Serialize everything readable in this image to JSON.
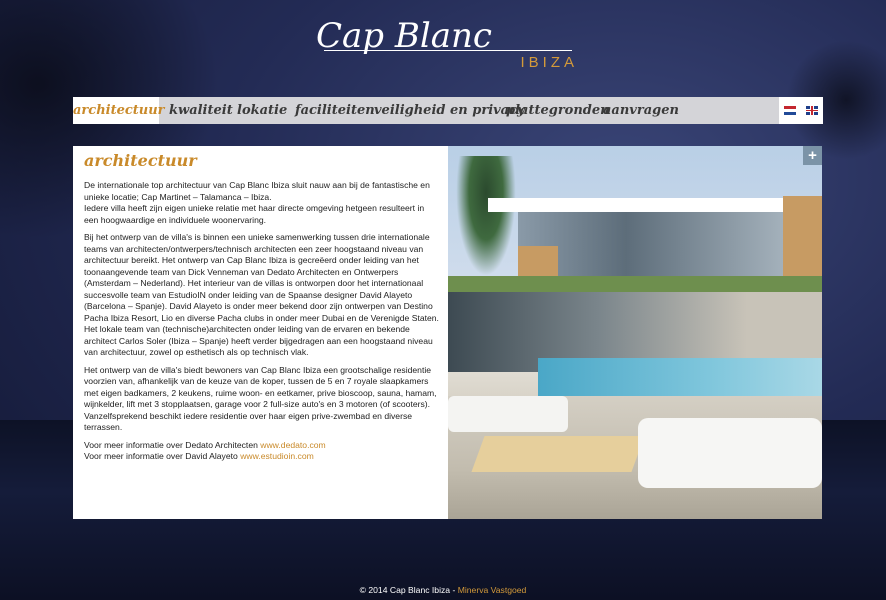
{
  "logo": {
    "main": "Cap Blanc",
    "sub": "IBIZA"
  },
  "nav": {
    "items": [
      {
        "label": "architectuur",
        "active": true
      },
      {
        "label": "kwaliteit"
      },
      {
        "label": "lokatie"
      },
      {
        "label": "faciliteiten"
      },
      {
        "label": "veiligheid en privacy"
      },
      {
        "label": "plattegronden"
      },
      {
        "label": "aanvragen"
      }
    ],
    "languages": [
      "nl",
      "en"
    ]
  },
  "content": {
    "title": "architectuur",
    "paragraphs": [
      "De internationale top architectuur van Cap Blanc Ibiza sluit nauw aan bij de fantastische en unieke locatie; Cap Martinet – Talamanca – Ibiza.",
      "Iedere villa heeft zijn eigen unieke relatie met haar directe omgeving hetgeen resulteert in een hoogwaardige en individuele woonervaring.",
      "Bij het ontwerp van de villa's is binnen een unieke samenwerking tussen drie internationale teams van architecten/ontwerpers/technisch architecten een zeer hoogstaand niveau van architectuur bereikt. Het ontwerp van Cap Blanc Ibiza is gecreëerd onder leiding van het toonaangevende team van Dick Venneman van Dedato Architecten en Ontwerpers (Amsterdam – Nederland). Het interieur van de villas is ontworpen door het internationaal succesvolle team van EstudioIN onder leiding van de Spaanse designer David Alayeto (Barcelona – Spanje). David Alayeto is onder meer bekend door zijn ontwerpen van Destino Pacha Ibiza Resort, Lio en diverse Pacha clubs in onder meer Dubai en de Verenigde Staten. Het lokale team van (technische)architecten onder leiding van de ervaren en bekende architect Carlos Soler (Ibiza – Spanje) heeft verder bijgedragen aan een hoogstaand niveau van architectuur, zowel op esthetisch als op technisch vlak.",
      "Het ontwerp van de villa's biedt bewoners van Cap Blanc Ibiza een grootschalige residentie voorzien van, afhankelijk van de keuze van de koper, tussen de 5 en 7 royale slaapkamers met eigen badkamers, 2 keukens, ruime woon- en eetkamer, prive bioscoop, sauna, hamam, wijnkelder, lift met 3 stopplaatsen, garage voor 2 full-size auto's en 3 motoren (of scooters). Vanzelfsprekend beschikt iedere residentie over haar eigen prive-zwembad en diverse terrassen."
    ],
    "links": [
      {
        "prefix": "Voor meer informatie over Dedato Architecten",
        "link": "www.dedato.com"
      },
      {
        "prefix": "Voor meer informatie over David Alayeto",
        "link": "www.estudioin.com"
      }
    ]
  },
  "photo": {
    "expand": "+"
  },
  "footer": {
    "text": "© 2014 Cap Blanc Ibiza - ",
    "link": "Minerva Vastgoed"
  },
  "colors": {
    "accent": "#c98a2a",
    "nav_bg": "#d4d4d8",
    "background": "#232b55"
  }
}
